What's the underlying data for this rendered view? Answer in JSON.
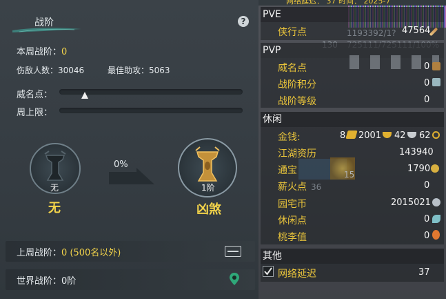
{
  "left": {
    "title": "战阶",
    "help_icon": "?",
    "weekly_rank_label": "本周战阶：",
    "weekly_rank_value": "0",
    "kills_label": "伤敌人数：",
    "kills_value": "30046",
    "assist_label": "最佳助攻：",
    "assist_value": "5063",
    "prestige_label": "威名点：",
    "prestige_progress": 0.14,
    "weekly_cap_label": "周上限：",
    "current_medal_caption": "无",
    "current_rank_name": "无",
    "progress_percent": "0%",
    "next_medal_caption": "1阶",
    "next_rank_name": "凶煞",
    "last_rank_label": "上周战阶：",
    "last_rank_value": "0 (500名以外)",
    "world_rank_label": "世界战阶：",
    "world_rank_value": "0阶"
  },
  "right": {
    "top_partial": "网络延迟：  37    时间： 2025-7",
    "pve_header": "PVE",
    "xiaxing_label": "侠行点",
    "xiaxing_value": "47564",
    "bg_numbers_1": "1193392/1?",
    "bg_numbers_2": "725111/725111/100%",
    "bg_level": "130",
    "pvp_header": "PVP",
    "pvp_items": [
      {
        "label": "威名点",
        "value": "0"
      },
      {
        "label": "战阶积分",
        "value": "0"
      },
      {
        "label": "战阶等级",
        "value": "0"
      }
    ],
    "leisure_header": "休闲",
    "money_label": "金钱:",
    "money_gold_bars": "8",
    "money_gold": "2001",
    "money_silver": "42",
    "money_copper": "62",
    "leisure_items": [
      {
        "label": "江湖资历",
        "value": "143940"
      },
      {
        "label": "通宝",
        "value": "1790"
      },
      {
        "label": "薪火点",
        "value": "0"
      },
      {
        "label": "园宅币",
        "value": "2015021"
      },
      {
        "label": "休闲点",
        "value": "0"
      },
      {
        "label": "桃李值",
        "value": "0"
      }
    ],
    "bg_small_1": "15",
    "bg_small_2": "36",
    "other_header": "其他",
    "latency_label": "网络延迟",
    "latency_value": "37",
    "latency_checked": true
  },
  "colors": {
    "accent_yellow": "#f2d34a",
    "item_gold": "#e9c43b",
    "panel_dark": "#353c42",
    "teal": "#3b8f88"
  }
}
